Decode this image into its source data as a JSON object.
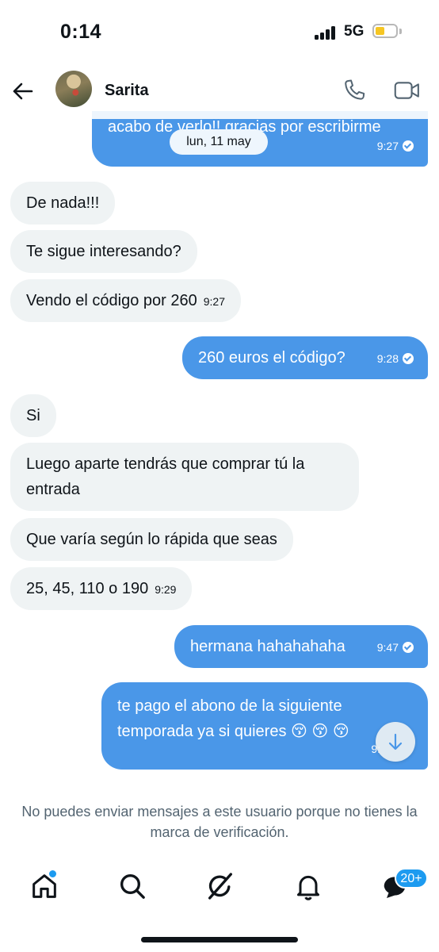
{
  "status_bar": {
    "time": "0:14",
    "network": "5G"
  },
  "header": {
    "contact_name": "Sarita"
  },
  "date_separator": "lun, 11 may",
  "messages": [
    {
      "direction": "out",
      "text": "acabo de verlo!! gracias por escribirme",
      "time": "9:27",
      "read": true
    },
    {
      "direction": "in",
      "text": "De nada!!!"
    },
    {
      "direction": "in",
      "text": "Te sigue interesando?"
    },
    {
      "direction": "in",
      "text": "Vendo el código por 260",
      "time": "9:27"
    },
    {
      "direction": "out",
      "text": "260 euros el código?",
      "time": "9:28",
      "read": true
    },
    {
      "direction": "in",
      "text": "Si"
    },
    {
      "direction": "in",
      "text": "Luego aparte tendrás que comprar tú la entrada"
    },
    {
      "direction": "in",
      "text": "Que varía según lo rápida que seas"
    },
    {
      "direction": "in",
      "text": "25, 45, 110 o 190",
      "time": "9:29"
    },
    {
      "direction": "out",
      "text": "hermana hahahahaha",
      "time": "9:47",
      "read": true
    },
    {
      "direction": "out",
      "text": "te pago el abono de la siguiente temporada ya si quieres 😚 😚 😚",
      "time": "9:",
      "read": true
    }
  ],
  "footer_notice": "No puedes enviar mensajes a este usuario porque no tienes la marca de verificación.",
  "tab_bar": {
    "messages_badge": "20+"
  },
  "colors": {
    "accent": "#1d9bf0",
    "outgoing_bubble": "#4a97e8",
    "incoming_bubble": "#eff3f4",
    "muted_text": "#536471"
  },
  "icons": [
    "back-arrow-icon",
    "phone-icon",
    "video-camera-icon",
    "arrow-down-icon",
    "home-icon",
    "search-icon",
    "grok-icon",
    "bell-icon",
    "messages-icon"
  ]
}
